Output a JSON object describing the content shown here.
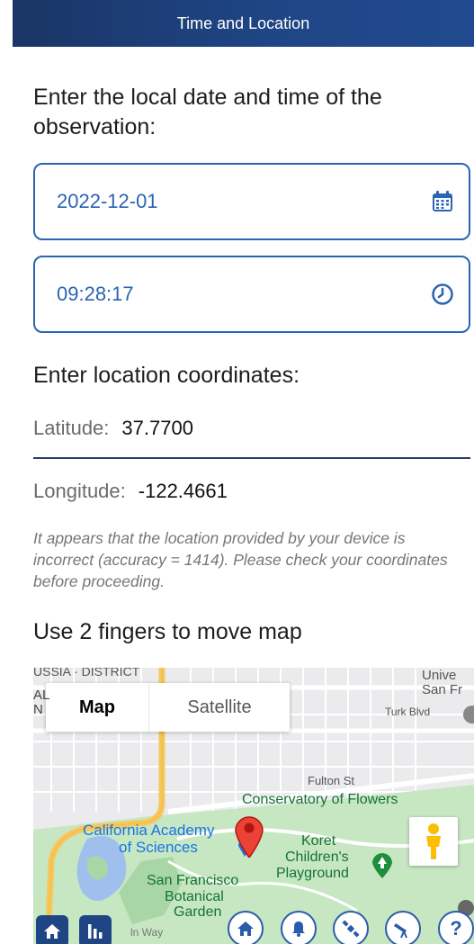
{
  "header": {
    "title": "Time and Location"
  },
  "datetime": {
    "prompt": "Enter the local date and time of the observation:",
    "date_value": "2022-12-01",
    "time_value": "09:28:17"
  },
  "location": {
    "prompt": "Enter location coordinates:",
    "latitude_label": "Latitude:",
    "latitude_value": "37.7700",
    "longitude_label": "Longitude:",
    "longitude_value": "-122.4661",
    "warning": "It appears that the location provided by your device is incorrect (accuracy = 1414). Please check your coordinates before proceeding."
  },
  "map": {
    "instruction": "Use 2 fingers to move map",
    "type_map": "Map",
    "type_satellite": "Satellite",
    "labels": {
      "turk": "Turk Blvd",
      "fulton": "Fulton St",
      "conservatory": "Conservatory of Flowers",
      "academy_1": "California Academy",
      "academy_2": "of Sciences",
      "koret_1": "Koret",
      "koret_2": "Children's",
      "koret_3": "Playground",
      "botanical_1": "San Francisco",
      "botanical_2": "Botanical",
      "botanical_3": "Garden",
      "corner_top_left": "USSIA · DISTRICT",
      "corner_left_1": "AL",
      "corner_left_2": "N",
      "corner_top_right_1": "Unive",
      "corner_top_right_2": "San Fr",
      "way": "ln Way"
    },
    "colors": {
      "park": "#c7e7c2",
      "road_major": "#f6c85c",
      "water": "#9fc0ec",
      "label_blue": "#1a73e8",
      "label_green": "#137333"
    }
  },
  "nav": {
    "buttons": [
      "home",
      "chart",
      "home-map",
      "bell",
      "satellite",
      "telescope",
      "help"
    ]
  },
  "theme": {
    "primary": "#1f4585",
    "accent": "#2b64b2"
  }
}
